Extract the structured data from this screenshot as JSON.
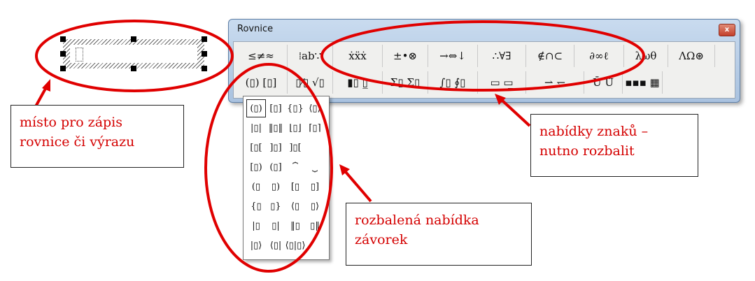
{
  "window": {
    "title": "Rovnice",
    "close_glyph": "x"
  },
  "toolbar": {
    "row1": [
      {
        "name": "relational-symbols",
        "glyphs": "≤≠≈"
      },
      {
        "name": "spaces-ellipses",
        "glyphs": "⁞ab∵"
      },
      {
        "name": "embellishments",
        "glyphs": "ẋẍẋ"
      },
      {
        "name": "operator-symbols",
        "glyphs": "±•⊗"
      },
      {
        "name": "arrow-symbols",
        "glyphs": "→⇔↓"
      },
      {
        "name": "logical-symbols",
        "glyphs": "∴∀∃"
      },
      {
        "name": "set-theory-symbols",
        "glyphs": "∉∩⊂"
      },
      {
        "name": "misc-symbols",
        "glyphs": "∂∞ℓ"
      },
      {
        "name": "greek-lowercase",
        "glyphs": "λωθ"
      },
      {
        "name": "greek-uppercase",
        "glyphs": "ΛΩ⊛"
      }
    ],
    "row2": [
      {
        "name": "fence-templates",
        "glyphs": "(▯) [▯]"
      },
      {
        "name": "fraction-radical-templates",
        "glyphs": "▯⁄▯ √▯"
      },
      {
        "name": "subscript-superscript-templates",
        "glyphs": "▮▯ ▯̲"
      },
      {
        "name": "summation-templates",
        "glyphs": "Σ▯ Σ▯"
      },
      {
        "name": "integral-templates",
        "glyphs": "∫▯ ∮▯"
      },
      {
        "name": "underbar-overbar-templates",
        "glyphs": "▭ ▭̲"
      },
      {
        "name": "labeled-arrow-templates",
        "glyphs": "⇀ ↽"
      },
      {
        "name": "products-set-templates",
        "glyphs": "Ū Ů"
      },
      {
        "name": "matrix-templates",
        "glyphs": "▪▪▪ ▦"
      }
    ]
  },
  "menu": {
    "rows": [
      [
        "(▯)",
        "[▯]",
        "{▯}",
        "⟨▯⟩"
      ],
      [
        "|▯|",
        "‖▯‖",
        "⌊▯⌋",
        "⌈▯⌉"
      ],
      [
        "[▯[",
        "]▯]",
        "]▯["
      ],
      [
        "[▯)",
        "(▯]",
        "⏞",
        "⏟"
      ],
      [
        "(▯",
        "▯)",
        "[▯",
        "▯]"
      ],
      [
        "{▯",
        "▯}",
        "⟨▯",
        "▯⟩"
      ],
      [
        "|▯",
        "▯|",
        "‖▯",
        "▯‖"
      ],
      [
        "|▯⟩",
        "⟨▯|",
        "⟨▯|▯⟩"
      ]
    ]
  },
  "annotations": {
    "placeholder_note": {
      "line1": "místo pro zápis",
      "line2": "rovnice či výrazu"
    },
    "symbols_note": {
      "line1": "nabídky znaků –",
      "line2": "nutno rozbalit"
    },
    "fence_note": {
      "line1": "rozbalená nabídka",
      "line2": "závorek"
    },
    "accent_color": "#e00000"
  }
}
